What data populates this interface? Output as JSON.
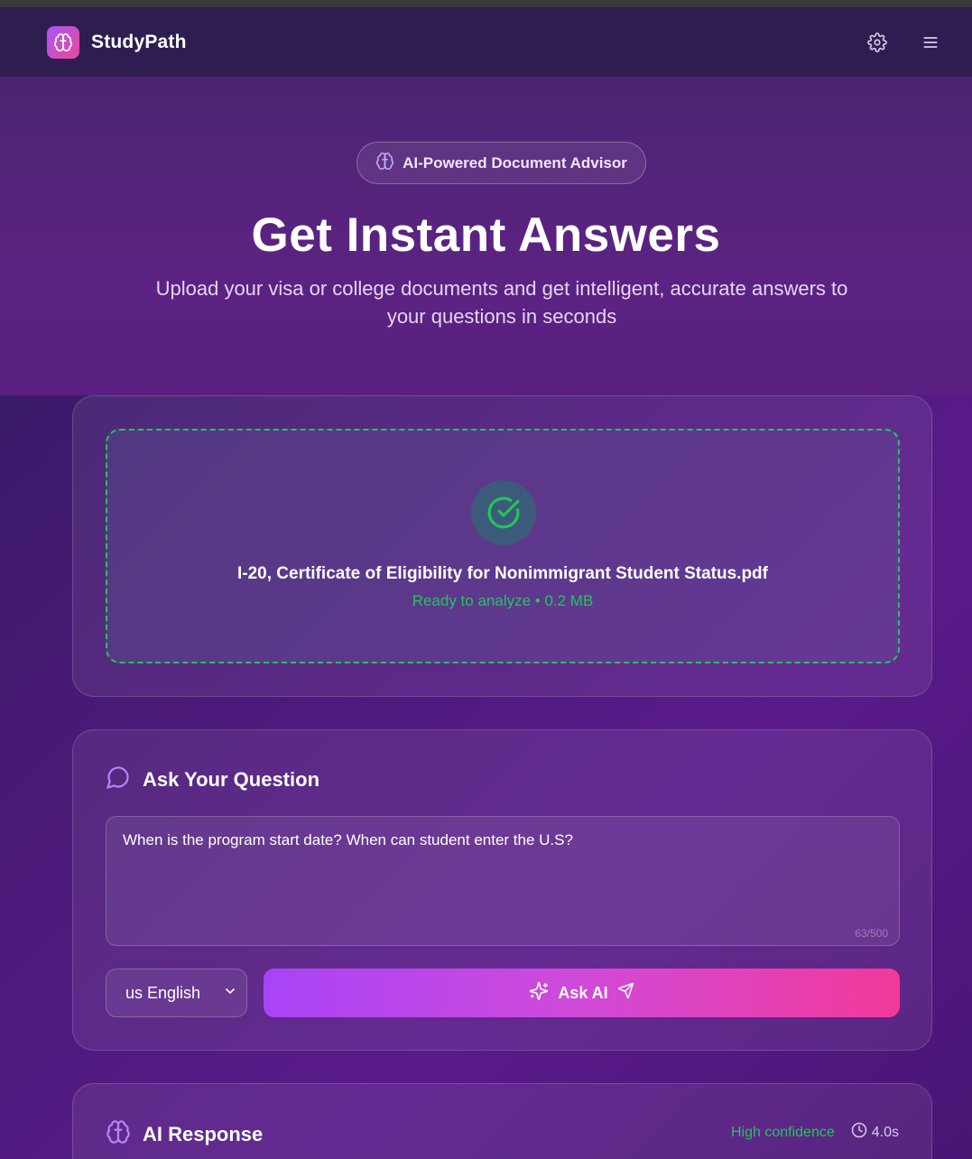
{
  "app": {
    "name": "StudyPath"
  },
  "nav": {
    "settings_icon": "gear-icon",
    "menu_icon": "hamburger-menu-icon"
  },
  "hero": {
    "badge": "AI-Powered Document Advisor",
    "title": "Get Instant Answers",
    "subtitle": "Upload your visa or college documents and get intelligent, accurate answers to your questions in seconds"
  },
  "upload": {
    "file_name": "I-20, Certificate of Eligibility for Nonimmigrant Student Status.pdf",
    "status": "Ready to analyze • 0.2 MB",
    "status_color": "#22c55e"
  },
  "question": {
    "heading": "Ask Your Question",
    "text": "When is the program start date? When can student enter the U.S?",
    "char_count": "63/500",
    "language": "us English",
    "ask_label": "Ask AI"
  },
  "response": {
    "heading": "AI Response",
    "confidence": "High confidence",
    "elapsed": "4.0s"
  },
  "colors": {
    "accent_purple": "#a855f7",
    "accent_pink": "#ec4899",
    "success": "#22c55e"
  }
}
